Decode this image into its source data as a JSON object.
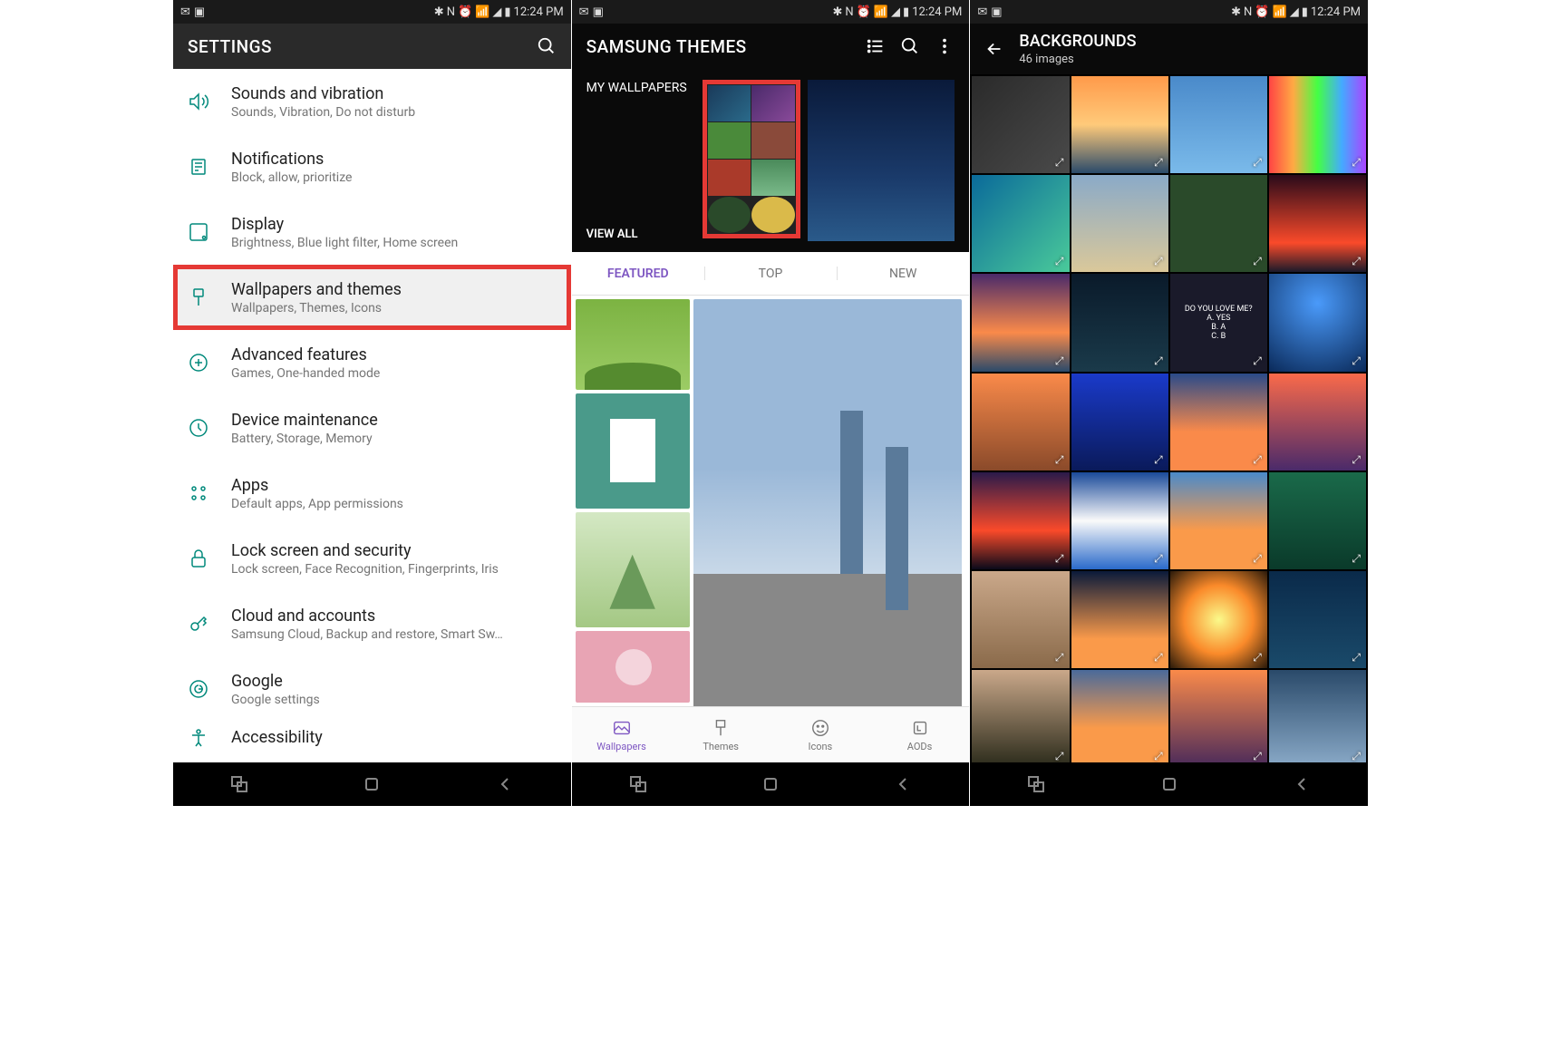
{
  "status": {
    "time": "12:24 PM"
  },
  "screen1": {
    "title": "SETTINGS",
    "items": [
      {
        "title": "Sounds and vibration",
        "sub": "Sounds, Vibration, Do not disturb",
        "icon": "volume"
      },
      {
        "title": "Notifications",
        "sub": "Block, allow, prioritize",
        "icon": "bell"
      },
      {
        "title": "Display",
        "sub": "Brightness, Blue light filter, Home screen",
        "icon": "display"
      },
      {
        "title": "Wallpapers and themes",
        "sub": "Wallpapers, Themes, Icons",
        "icon": "brush",
        "highlighted": true
      },
      {
        "title": "Advanced features",
        "sub": "Games, One-handed mode",
        "icon": "plus"
      },
      {
        "title": "Device maintenance",
        "sub": "Battery, Storage, Memory",
        "icon": "maint"
      },
      {
        "title": "Apps",
        "sub": "Default apps, App permissions",
        "icon": "apps"
      },
      {
        "title": "Lock screen and security",
        "sub": "Lock screen, Face Recognition, Fingerprints, Iris",
        "icon": "lock"
      },
      {
        "title": "Cloud and accounts",
        "sub": "Samsung Cloud, Backup and restore, Smart Sw…",
        "icon": "key"
      },
      {
        "title": "Google",
        "sub": "Google settings",
        "icon": "google"
      },
      {
        "title": "Accessibility",
        "sub": "",
        "icon": "access"
      }
    ]
  },
  "screen2": {
    "title": "SAMSUNG THEMES",
    "hero_label": "MY WALLPAPERS",
    "view_all": "VIEW ALL",
    "tabs": [
      "FEATURED",
      "TOP",
      "NEW"
    ],
    "bottom_nav": [
      "Wallpapers",
      "Themes",
      "Icons",
      "AODs"
    ]
  },
  "screen3": {
    "title": "BACKGROUNDS",
    "subtitle": "46 images",
    "quote_tile": "DO YOU LOVE ME?\nA. YES\nB. A\nC. B"
  }
}
